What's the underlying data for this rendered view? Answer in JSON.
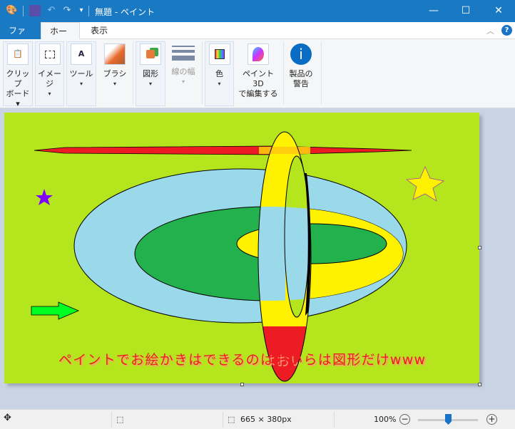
{
  "title": "無題 - ペイント",
  "quick_access": {
    "save": "save-icon",
    "undo": "undo-icon",
    "redo": "redo-icon",
    "customize": "▾"
  },
  "tabs": {
    "file": "ファイル",
    "home": "ホーム",
    "view": "表示"
  },
  "ribbon": {
    "clipboard": [
      "クリップ",
      "ボード ▾"
    ],
    "image": [
      "イメージ",
      "▾"
    ],
    "tools": [
      "ツール",
      "▾"
    ],
    "brushes": [
      "ブラシ",
      "▾"
    ],
    "shapes": [
      "図形",
      "▾"
    ],
    "size": [
      "線の幅",
      "▾"
    ],
    "colors": [
      "色",
      "▾"
    ],
    "paint3d": [
      "ペイント 3D",
      "で編集する"
    ],
    "alert": [
      "製品の",
      "警告"
    ]
  },
  "canvas": {
    "caption": "ペイントでお絵かきはできるのはおいらは図形だけwww",
    "colors": {
      "background": "#b5e61d",
      "light_blue": "#99d9ea",
      "green": "#22b14c",
      "yellow": "#fff200",
      "red": "#ed1c24",
      "orange": "#ffc90e",
      "purple": "#8000ff",
      "arrow": "#00ff21"
    }
  },
  "status": {
    "dimensions": "665 × 380px",
    "zoom": "100%",
    "zoom_level": 0.5
  }
}
